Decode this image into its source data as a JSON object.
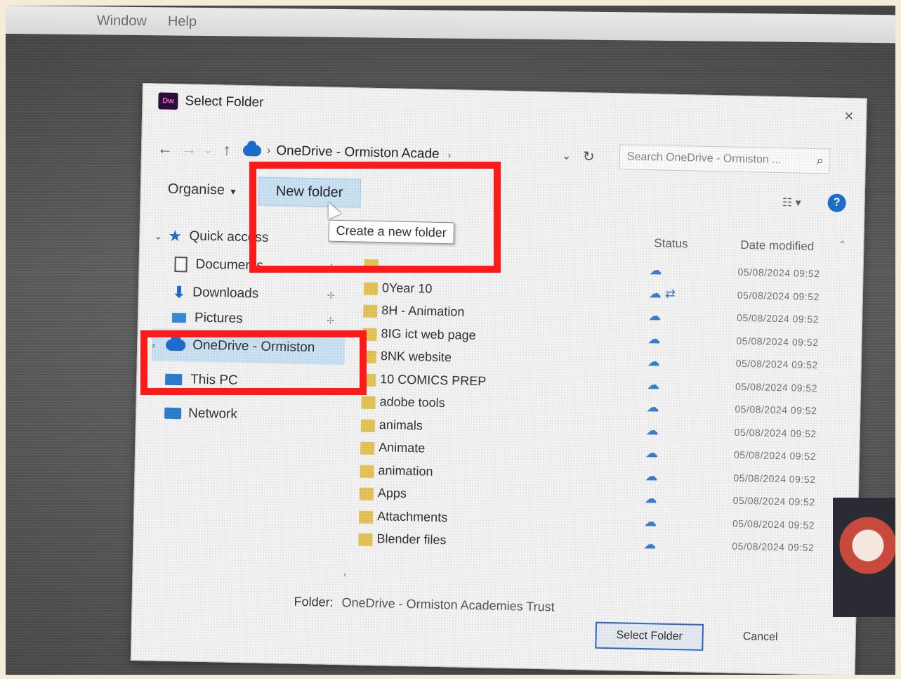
{
  "menubar": [
    "Window",
    "Help"
  ],
  "dialog": {
    "title": "Select Folder",
    "app_icon_text": "Dw",
    "close": "×"
  },
  "address": {
    "back": "←",
    "forward": "→",
    "recent": "⌄",
    "up": "↑",
    "crumb": "OneDrive - Ormiston Acade",
    "crumb_tail": "›",
    "dropdown": "⌄",
    "refresh": "↻",
    "search_placeholder": "Search OneDrive - Ormiston ..."
  },
  "toolbar": {
    "organise": "Organise",
    "new_folder": "New folder",
    "tooltip": "Create a new folder",
    "view": "☷ ▾",
    "help": "?"
  },
  "nav": {
    "quick_access": "Quick access",
    "documents": "Documents",
    "downloads": "Downloads",
    "pictures": "Pictures",
    "onedrive": "OneDrive - Ormiston",
    "this_pc": "This PC",
    "network": "Network",
    "pin": "✢"
  },
  "columns": {
    "status": "Status",
    "date_modified": "Date modified"
  },
  "files": [
    {
      "name": "",
      "status": "☁",
      "date": "05/08/2024 09:52"
    },
    {
      "name": "0Year 10",
      "status": "☁ ⇄",
      "date": "05/08/2024 09:52"
    },
    {
      "name": "8H - Animation",
      "status": "☁",
      "date": "05/08/2024 09:52"
    },
    {
      "name": "8IG ict web page",
      "status": "☁",
      "date": "05/08/2024 09:52"
    },
    {
      "name": "8NK website",
      "status": "☁",
      "date": "05/08/2024 09:52"
    },
    {
      "name": "10 COMICS PREP",
      "status": "☁",
      "date": "05/08/2024 09:52"
    },
    {
      "name": "adobe tools",
      "status": "☁",
      "date": "05/08/2024 09:52"
    },
    {
      "name": "animals",
      "status": "☁",
      "date": "05/08/2024 09:52"
    },
    {
      "name": "Animate",
      "status": "☁",
      "date": "05/08/2024 09:52"
    },
    {
      "name": "animation",
      "status": "☁",
      "date": "05/08/2024 09:52"
    },
    {
      "name": "Apps",
      "status": "☁",
      "date": "05/08/2024 09:52"
    },
    {
      "name": "Attachments",
      "status": "☁",
      "date": "05/08/2024 09:52"
    },
    {
      "name": "Blender files",
      "status": "☁",
      "date": "05/08/2024 09:52"
    }
  ],
  "footer": {
    "folder_label": "Folder:",
    "folder_value": "OneDrive - Ormiston Academies Trust",
    "select_button": "Select Folder",
    "cancel_button": "Cancel"
  },
  "colors": {
    "highlight": "#ff1a1a",
    "accent": "#1e6fd1"
  }
}
